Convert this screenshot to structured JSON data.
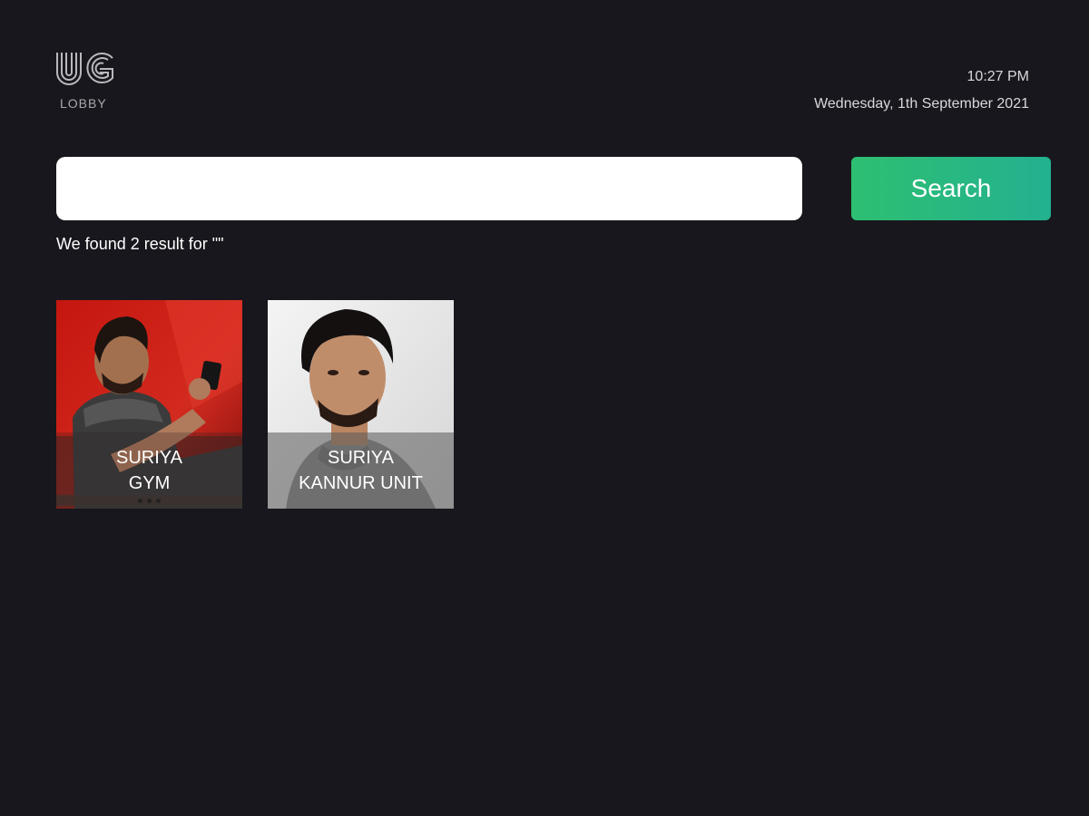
{
  "logo": {
    "mark": "UG",
    "label": "LOBBY"
  },
  "clock": {
    "time": "10:27 PM",
    "date": "Wednesday, 1th September 2021"
  },
  "search": {
    "value": "",
    "placeholder": "",
    "button_label": "Search"
  },
  "results": {
    "summary": "We found 2 result for \"\"",
    "items": [
      {
        "line1": "SURIYA",
        "line2": "GYM",
        "image": "person-photo-red-background"
      },
      {
        "line1": "SURIYA",
        "line2": "KANNUR UNIT",
        "image": "person-portrait-light-background"
      }
    ]
  },
  "colors": {
    "background": "#18171d",
    "accent_start": "#2dbf71",
    "accent_end": "#23b190"
  }
}
